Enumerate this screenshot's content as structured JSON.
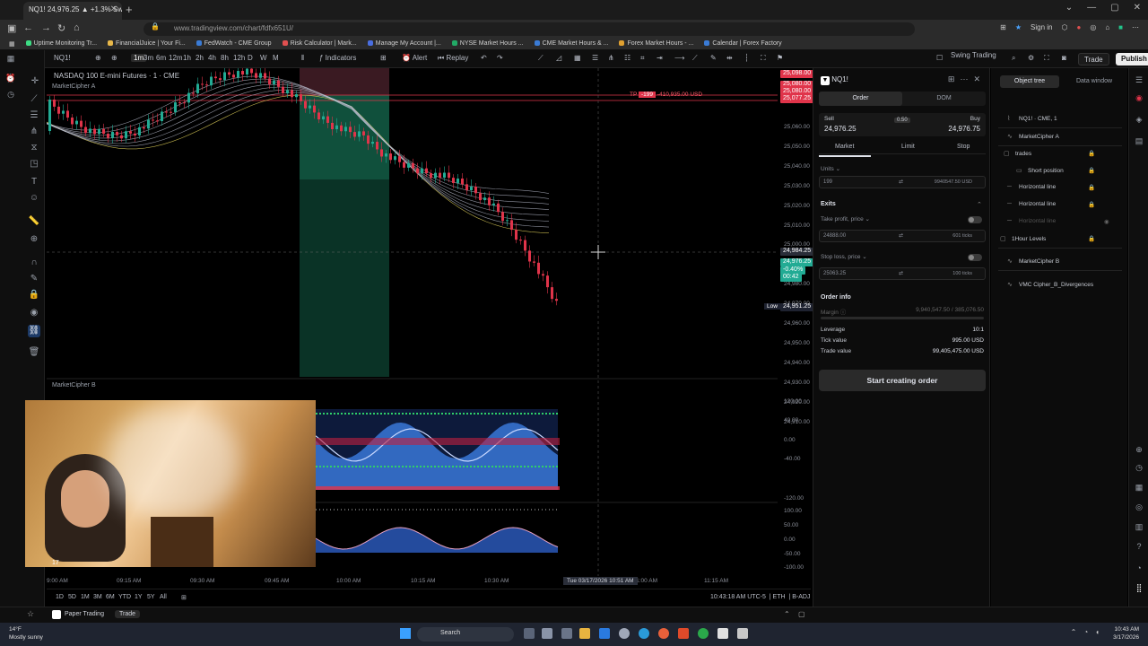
{
  "browser": {
    "tab_title": "NQ1! 24,976.25 ▲ +1.3% Swing",
    "url": "www.tradingview.com/chart/fdfx651U/",
    "sign_in": "Sign in",
    "bookmarks": [
      {
        "label": "Uptime Monitoring Tr...",
        "color": "#3ddc84"
      },
      {
        "label": "FinancialJuice | Your Fi...",
        "color": "#e8b84a"
      },
      {
        "label": "FedWatch - CME Group",
        "color": "#3a7bd5"
      },
      {
        "label": "Risk Calculator | Mark...",
        "color": "#e05050"
      },
      {
        "label": "Manage My Account |...",
        "color": "#4a6ee0"
      },
      {
        "label": "NYSE Market Hours ...",
        "color": "#22aa66"
      },
      {
        "label": "CME Market Hours & ...",
        "color": "#3a7bd5"
      },
      {
        "label": "Forex Market Hours - ...",
        "color": "#e0a030"
      },
      {
        "label": "Calendar | Forex Factory",
        "color": "#3a7bd5"
      }
    ]
  },
  "toolbar": {
    "symbol": "NQ1!",
    "timeframes": [
      "1m",
      "3m",
      "6m",
      "12m",
      "1h",
      "2h",
      "4h",
      "8h",
      "12h",
      "D",
      "W",
      "M"
    ],
    "indicators_label": "Indicators",
    "alert_label": "Alert",
    "replay_label": "Replay",
    "layout_name": "Swing Trading",
    "trade_label": "Trade",
    "publish_label": "Publish"
  },
  "chart": {
    "title": "NASDAQ 100 E-mini Futures · 1 · CME",
    "indicator_a": "MarketCipher A",
    "indicator_b": "MarketCipher B",
    "price_ticks": [
      "25,060.00",
      "25,050.00",
      "25,040.00",
      "25,030.00",
      "25,020.00",
      "25,010.00",
      "25,000.00",
      "24,990.00",
      "24,980.00",
      "24,970.00",
      "24,960.00",
      "24,950.00",
      "24,940.00",
      "24,930.00",
      "24,920.00",
      "24,910.00"
    ],
    "price_tags": [
      {
        "text": "25,098.00",
        "color": "#e0344a"
      },
      {
        "text": "25,080.00",
        "color": "#e0344a"
      },
      {
        "text": "25,080.00",
        "color": "#e0344a"
      },
      {
        "text": "25,077.25",
        "color": "#e0344a"
      },
      {
        "text": "24,984.25",
        "color": "#2a2e39"
      },
      {
        "text": "24,976.25",
        "color": "#22ab94"
      }
    ],
    "current_price_change": "-0.40%",
    "current_price_timer": "00:42",
    "low_label": "Low",
    "low_value": "24,951.25",
    "tp_label": "TP",
    "position_qty": "-199",
    "position_pnl": "-410,935.00 USD",
    "mcb_ticks": [
      "120.00",
      "40.00",
      "0.00",
      "-40.00",
      "-120.00"
    ],
    "mcb2_ticks": [
      "100.00",
      "50.00",
      "0.00",
      "-50.00",
      "-100.00"
    ],
    "time_ticks": [
      "9:00 AM",
      "09:15 AM",
      "09:30 AM",
      "09:45 AM",
      "10:00 AM",
      "10:15 AM",
      "10:30 AM",
      "11:00 AM",
      "11:15 AM"
    ],
    "crosshair_date": "Tue 03/17/2026   10:51 AM",
    "ranges": [
      "1D",
      "5D",
      "1M",
      "3M",
      "6M",
      "YTD",
      "1Y",
      "5Y",
      "All"
    ],
    "clock": "10:43:18 AM UTC-5",
    "session": "ETH",
    "adj": "B-ADJ",
    "webcam_counter": "17"
  },
  "order_panel": {
    "symbol": "NQ1!",
    "tab_order": "Order",
    "tab_dom": "DOM",
    "sell_label": "Sell",
    "sell_price": "24,976.25",
    "buy_label": "Buy",
    "buy_price": "24,976.75",
    "spread": "0.50",
    "type_market": "Market",
    "type_limit": "Limit",
    "type_stop": "Stop",
    "units_label": "Units",
    "units_value": "199",
    "units_usd": "9940547.50 USD",
    "exits_label": "Exits",
    "tp_label": "Take profit, price",
    "tp_value": "24888.00",
    "tp_ticks": "601 ticks",
    "sl_label": "Stop loss, price",
    "sl_value": "25063.25",
    "sl_ticks": "100 ticks",
    "order_info_label": "Order info",
    "margin_label": "Margin",
    "margin_value": "9,940,547.50 / 385,076.50",
    "leverage_label": "Leverage",
    "leverage_value": "10:1",
    "tick_value_label": "Tick value",
    "tick_value": "995.00 USD",
    "trade_value_label": "Trade value",
    "trade_value": "99,405,475.00 USD",
    "start_button": "Start creating order"
  },
  "object_tree": {
    "tab_tree": "Object tree",
    "tab_data": "Data window",
    "items": [
      {
        "label": "NQ1! · CME, 1",
        "icon": "chart-icon"
      },
      {
        "label": "MarketCipher A",
        "icon": "indicator-icon"
      },
      {
        "label": "trades",
        "icon": "folder-icon"
      },
      {
        "label": "Short position",
        "icon": "position-icon"
      },
      {
        "label": "Horizontal line",
        "icon": "line-icon"
      },
      {
        "label": "Horizontal line",
        "icon": "line-icon"
      },
      {
        "label": "Horizontal line",
        "icon": "line-icon"
      },
      {
        "label": "1Hour Levels",
        "icon": "folder-icon"
      },
      {
        "label": "MarketCipher B",
        "icon": "indicator-icon"
      },
      {
        "label": "VMC Cipher_B_Divergences",
        "icon": "indicator-icon"
      }
    ]
  },
  "footer": {
    "paper_trading": "Paper Trading",
    "trade": "Trade"
  },
  "taskbar": {
    "weather_temp": "14°F",
    "weather_desc": "Mostly sunny",
    "search": "Search",
    "time": "10:43 AM",
    "date": "3/17/2026"
  }
}
